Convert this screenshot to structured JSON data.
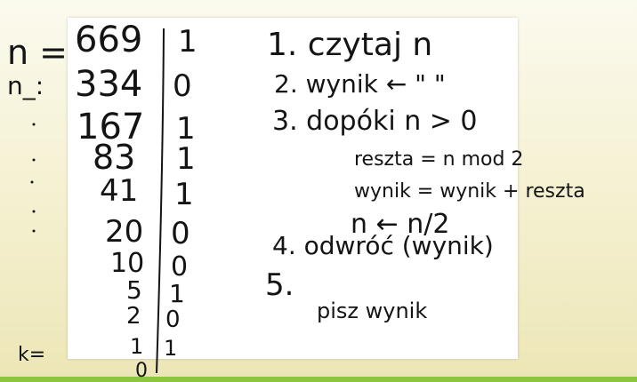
{
  "left_margin": {
    "n_label_top": "n =",
    "n_label_second": "n_:",
    "k_label_bottom": "k="
  },
  "binary_table": {
    "rows": [
      {
        "value": "669",
        "bit": "1"
      },
      {
        "value": "334",
        "bit": "0"
      },
      {
        "value": "167",
        "bit": "1"
      },
      {
        "value": "83",
        "bit": "1"
      },
      {
        "value": "41",
        "bit": "1"
      },
      {
        "value": "20",
        "bit": "0"
      },
      {
        "value": "10",
        "bit": "0"
      },
      {
        "value": "5",
        "bit": "1"
      },
      {
        "value": "2",
        "bit": "0"
      },
      {
        "value": "1",
        "bit": "1"
      },
      {
        "value": "0",
        "bit": ""
      }
    ]
  },
  "algorithm": {
    "step1": "1. czytaj n",
    "step2": "2. wynik ← \" \"",
    "step3": "3. dopóki n > 0",
    "step3_body": [
      "reszta = n mod 2",
      "wynik = wynik + reszta",
      "n ← n/2"
    ],
    "step4": "4. odwróć (wynik)",
    "step5": "5.",
    "step5_body": "pisz wynik"
  },
  "colors": {
    "ink": "#141414",
    "accent_bar": "#8cc63f",
    "background": "#f4f0cf"
  }
}
